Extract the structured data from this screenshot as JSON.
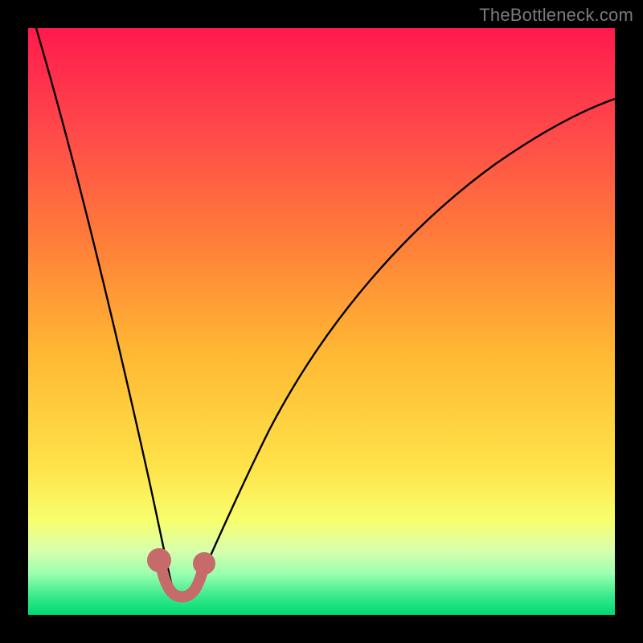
{
  "watermark": "TheBottleneck.com",
  "chart_data": {
    "type": "line",
    "title": "",
    "xlabel": "",
    "ylabel": "",
    "xlim": [
      0,
      100
    ],
    "ylim": [
      0,
      100
    ],
    "grid": false,
    "legend": false,
    "annotations": [],
    "series": [
      {
        "name": "bottleneck-curve",
        "color": "#000000",
        "x": [
          1,
          5,
          10,
          15,
          18,
          20,
          22,
          23,
          24,
          25,
          26,
          27,
          28,
          29,
          30,
          32,
          35,
          40,
          50,
          60,
          70,
          80,
          90,
          100
        ],
        "y": [
          100,
          82,
          60,
          40,
          27,
          19,
          11,
          7,
          5,
          4,
          4,
          4,
          5,
          7,
          10,
          16,
          24,
          34,
          49,
          59,
          67,
          74,
          80,
          85
        ]
      },
      {
        "name": "highlight-band",
        "color": "#cc6666",
        "x": [
          22,
          23,
          24,
          25,
          26,
          27,
          28
        ],
        "y": [
          10,
          6,
          4.5,
          4,
          4.2,
          5,
          7
        ]
      }
    ],
    "optimal_x": 25,
    "background_gradient": {
      "top": "#ff1a4d",
      "bottom": "#00d873",
      "meaning": "red = high bottleneck, green = low bottleneck"
    }
  }
}
